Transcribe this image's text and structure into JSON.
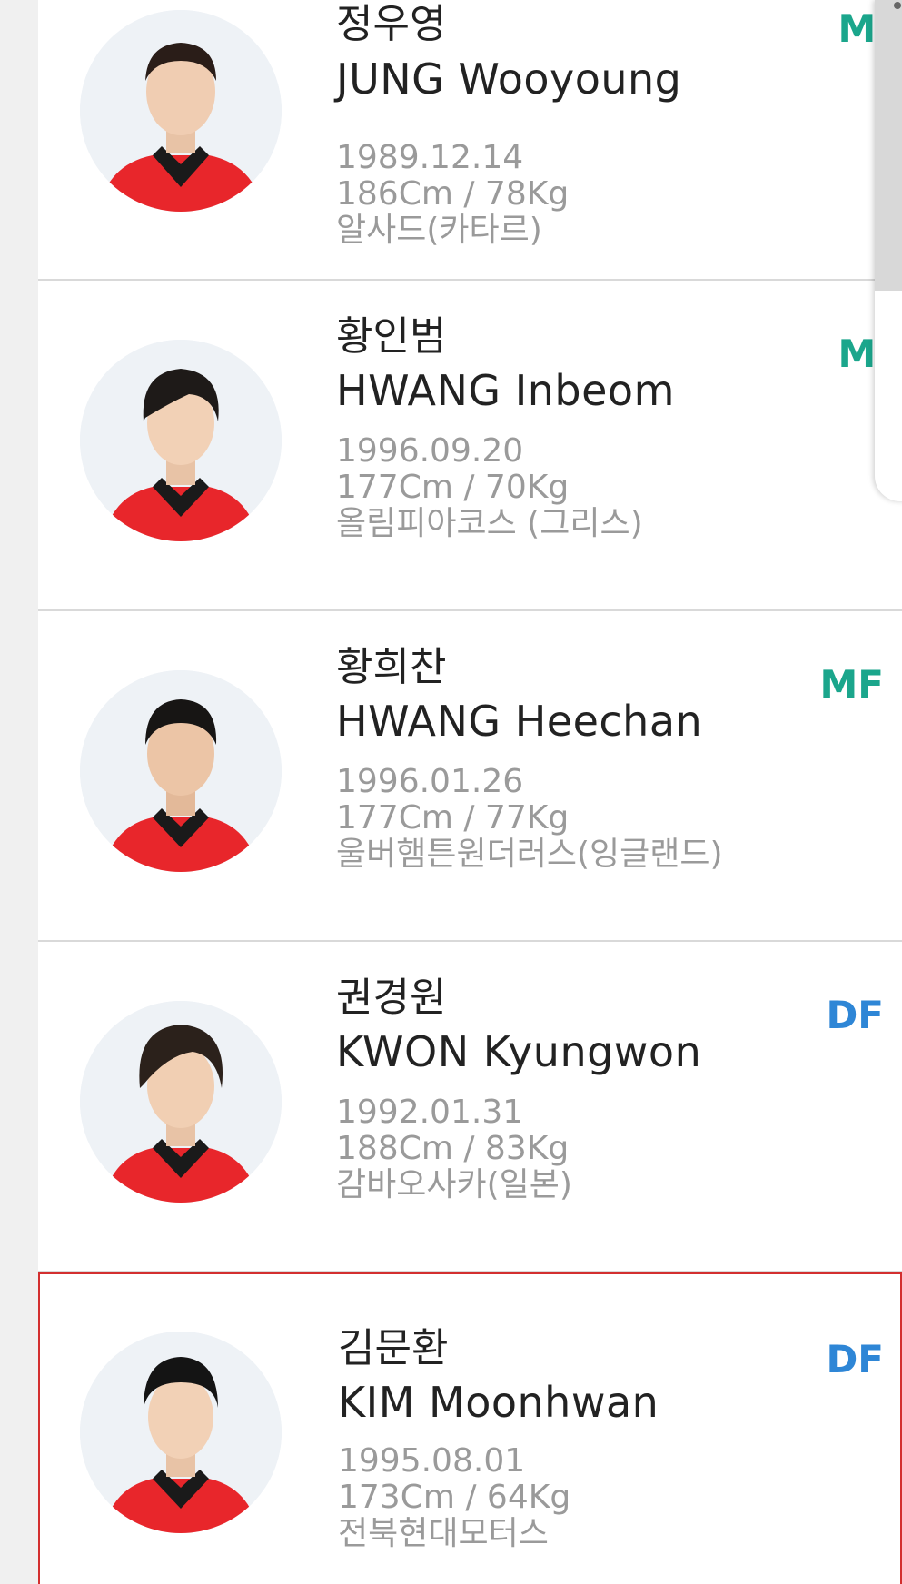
{
  "players": [
    {
      "name_ko": "정우영",
      "name_en": "JUNG Wooyoung",
      "birth": "1989.12.14",
      "body": "186Cm / 78Kg",
      "club": "알사드(카타르)",
      "position": "MF",
      "position_visible": "MF"
    },
    {
      "name_ko": "황인범",
      "name_en": "HWANG Inbeom",
      "birth": "1996.09.20",
      "body": "177Cm / 70Kg",
      "club": "올림피아코스 (그리스)",
      "position": "MF",
      "position_visible": "MF"
    },
    {
      "name_ko": "황희찬",
      "name_en": "HWANG Heechan",
      "birth": "1996.01.26",
      "body": "177Cm / 77Kg",
      "club": "울버햄튼원더러스(잉글랜드)",
      "position": "MF",
      "position_visible": "MF"
    },
    {
      "name_ko": "권경원",
      "name_en": "KWON Kyungwon",
      "birth": "1992.01.31",
      "body": "188Cm / 83Kg",
      "club": "감바오사카(일본)",
      "position": "DF",
      "position_visible": "DF"
    },
    {
      "name_ko": "김문환",
      "name_en": "KIM Moonhwan",
      "birth": "1995.08.01",
      "body": "173Cm / 64Kg",
      "club": "전북현대모터스",
      "position": "DF",
      "position_visible": "DF"
    }
  ],
  "colors": {
    "mf": "#1ba68c",
    "df": "#2e86d6",
    "selected_border": "#d32f2f",
    "jersey": "#e8262b"
  }
}
